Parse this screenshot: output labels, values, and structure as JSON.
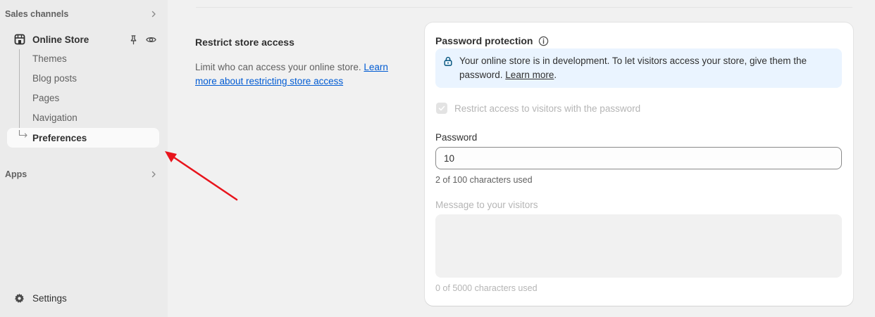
{
  "sidebar": {
    "sales_channels_label": "Sales channels",
    "online_store_label": "Online Store",
    "sub_items": [
      "Themes",
      "Blog posts",
      "Pages",
      "Navigation"
    ],
    "preferences_label": "Preferences",
    "apps_label": "Apps",
    "settings_label": "Settings"
  },
  "main": {
    "section_title": "Restrict store access",
    "section_desc": "Limit who can access your online store.",
    "section_link": "Learn more about restricting store access"
  },
  "card": {
    "title": "Password protection",
    "banner_text": "Your online store is in development. To let visitors access your store, give them the password.",
    "banner_link": "Learn more",
    "banner_end": ".",
    "checkbox_label": "Restrict access to visitors with the password",
    "checkbox_checked": true,
    "password_label": "Password",
    "password_value": "10",
    "password_help": "2 of 100 characters used",
    "message_label": "Message to your visitors",
    "message_value": "",
    "message_help": "0 of 5000 characters used"
  },
  "colors": {
    "link": "#005bd3",
    "banner_bg": "#eaf4ff",
    "annotation_arrow": "#e8141c"
  },
  "icons": [
    "chevron-right-icon",
    "store-icon",
    "pin-icon",
    "eye-icon",
    "settings-gear-icon",
    "info-icon",
    "lock-icon",
    "checkmark-icon"
  ]
}
